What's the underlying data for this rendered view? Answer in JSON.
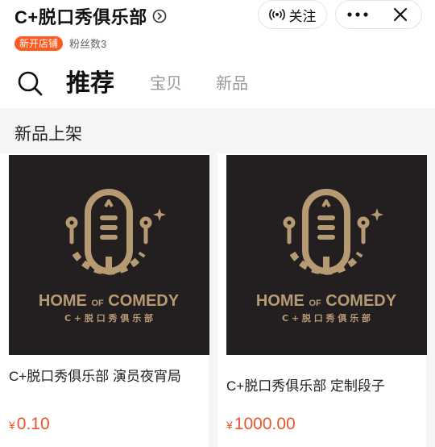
{
  "header": {
    "shop_name": "C+脱口秀俱乐部",
    "follow_label": "关注",
    "badge_new_shop": "新开店铺",
    "fans": "粉丝数3"
  },
  "tabs": [
    {
      "label": "推荐",
      "active": true
    },
    {
      "label": "宝贝",
      "active": false
    },
    {
      "label": "新品",
      "active": false
    }
  ],
  "section": {
    "title": "新品上架"
  },
  "logo": {
    "line1": "HOME",
    "line1_small": "OF",
    "line1b": "COMEDY",
    "line2": "C + 脱 口 秀 俱 乐 部"
  },
  "products": [
    {
      "title": "C+脱口秀俱乐部 演员夜宵局",
      "currency": "¥",
      "price": "0.10"
    },
    {
      "title": "C+脱口秀俱乐部 定制段子",
      "currency": "¥",
      "price": "1000.00"
    }
  ],
  "colors": {
    "accent": "#ff5a1f",
    "price": "#e8542c",
    "logo_gold": "#b59a72",
    "image_bg": "#231f20"
  },
  "icons": [
    "circle-chevron-icon",
    "broadcast-icon",
    "more-icon",
    "close-icon",
    "search-icon",
    "sparkle-icon",
    "microphone-icon"
  ]
}
